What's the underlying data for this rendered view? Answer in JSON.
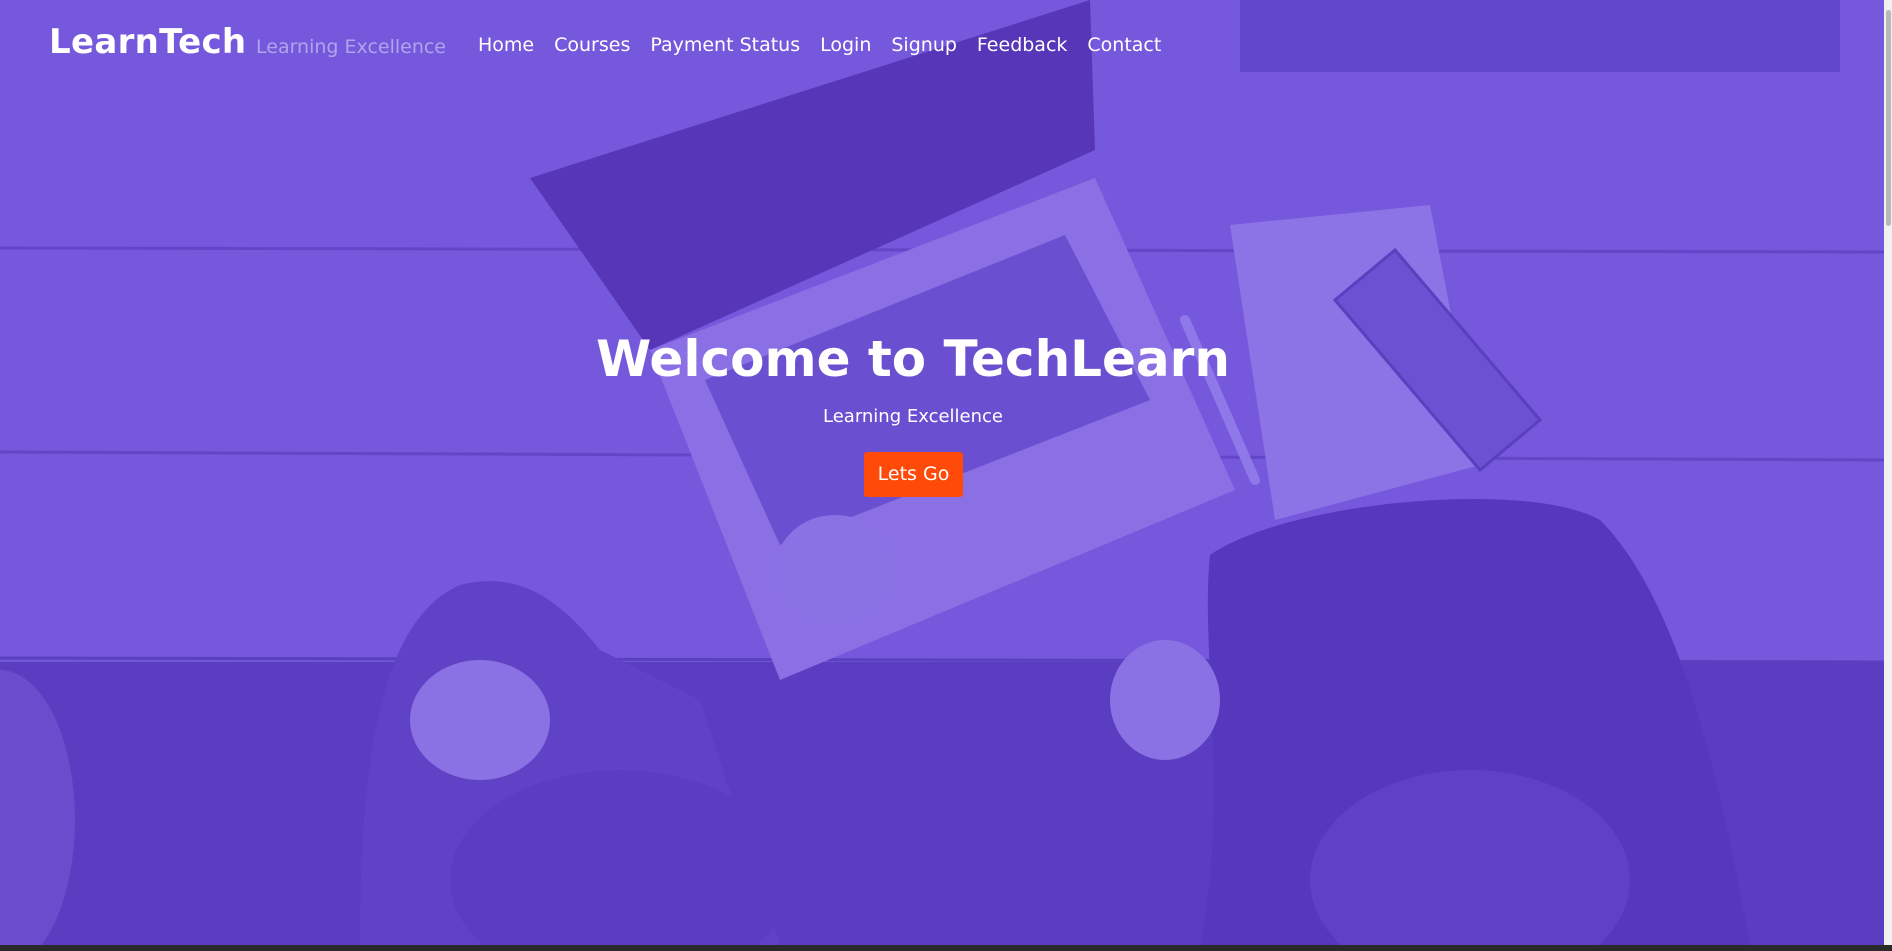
{
  "brand": {
    "name": "LearnTech",
    "tagline": "Learning Excellence"
  },
  "nav": {
    "items": [
      {
        "label": "Home"
      },
      {
        "label": "Courses"
      },
      {
        "label": "Payment Status"
      },
      {
        "label": "Login"
      },
      {
        "label": "Signup"
      },
      {
        "label": "Feedback"
      },
      {
        "label": "Contact"
      }
    ]
  },
  "hero": {
    "title": "Welcome to TechLearn",
    "subtitle": "Learning Excellence",
    "cta_label": "Lets Go",
    "background_image": "purple-tinted-desk-laptop-photo"
  },
  "colors": {
    "overlay_purple": "#7355dc",
    "cta_orange": "#ff4a0a",
    "text_white": "#ffffff",
    "tagline_muted": "#b3a3ec"
  }
}
